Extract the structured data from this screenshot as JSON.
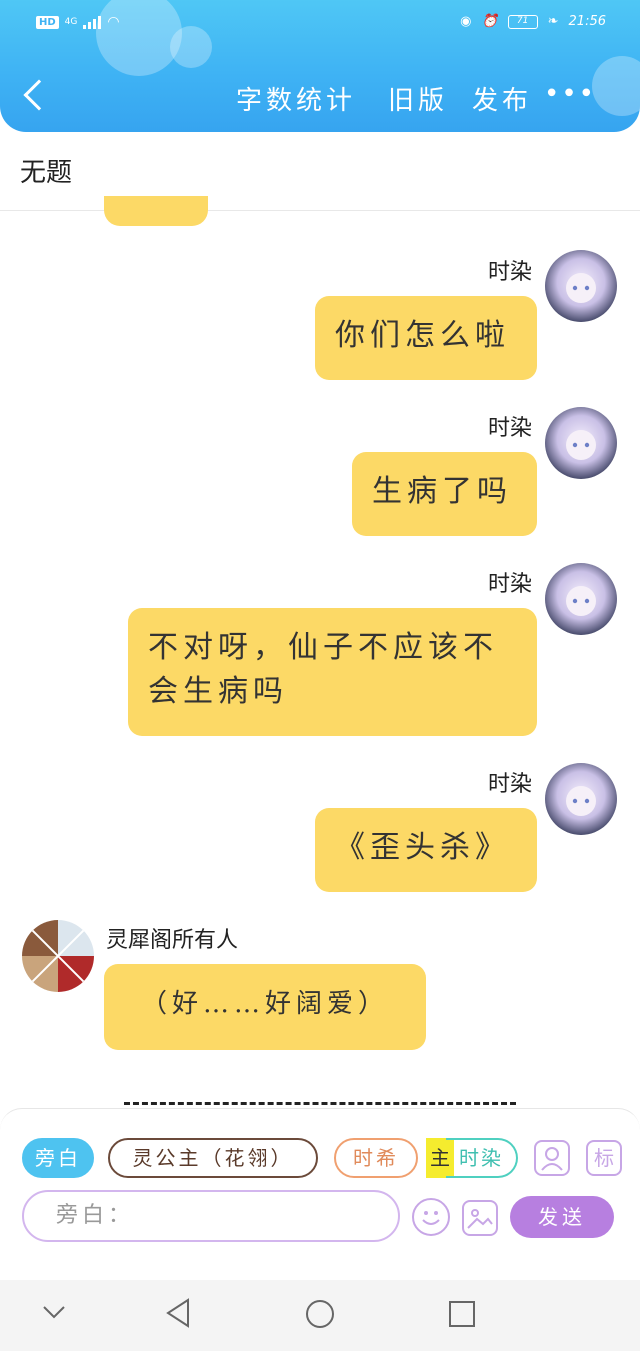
{
  "status_bar": {
    "network": "HD",
    "signal_label": "4G",
    "battery": "71",
    "time": "21:56"
  },
  "header": {
    "back_icon": "chevron-left-icon",
    "word_count": "字数统计",
    "old_version": "旧版",
    "publish": "发布",
    "more_icon": "more-dots-icon"
  },
  "document": {
    "title": "无题"
  },
  "messages": [
    {
      "side": "right",
      "name": "时染",
      "text": "你们怎么啦"
    },
    {
      "side": "right",
      "name": "时染",
      "text": "生病了吗"
    },
    {
      "side": "right",
      "name": "时染",
      "text": "不对呀，仙子不应该不会生病吗"
    },
    {
      "side": "right",
      "name": "时染",
      "text": "《歪头杀》"
    },
    {
      "side": "left",
      "name": "灵犀阁所有人",
      "text": "（好……好阔爱）"
    }
  ],
  "composer": {
    "chips": [
      "旁白",
      "灵公主（花翎）",
      "时希",
      "时染"
    ],
    "chip_highlight": "主",
    "input_placeholder": "旁白：",
    "send_label": "发送",
    "icon_user": "user-card-icon",
    "icon_tag": "标",
    "icon_emoji": "emoji-icon",
    "icon_image": "image-icon"
  },
  "colors": {
    "header": "#3fb3f4",
    "bubble": "#fcd966",
    "accent_purple": "#b77fe0",
    "chip_blue": "#4ec3f0",
    "chip_brown": "#6b4a3a",
    "chip_orange": "#f0a070",
    "chip_teal": "#4fd0c0"
  }
}
